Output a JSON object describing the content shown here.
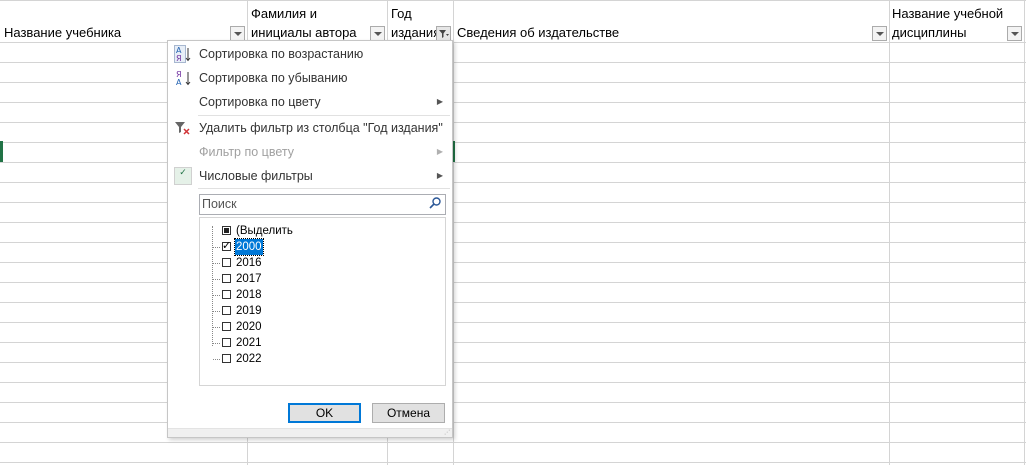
{
  "headers": {
    "col1": "Название учебника",
    "col2_line1": "Фамилия и",
    "col2_line2": "инициалы автора",
    "col3_line1": "Год",
    "col3_line2": "издания",
    "col4": "Сведения об издательстве",
    "col5_line1": "Название учебной",
    "col5_line2": "дисциплины"
  },
  "menu": {
    "sort_asc": "Сортировка по возрастанию",
    "sort_desc": "Сортировка по убыванию",
    "sort_color": "Сортировка по цвету",
    "clear_filter": "Удалить фильтр из столбца \"Год издания\"",
    "filter_color": "Фильтр по цвету",
    "number_filters": "Числовые фильтры",
    "search_placeholder": "Поиск",
    "select_all": "(Выделить все)",
    "items": [
      {
        "label": "2000",
        "checked": true
      },
      {
        "label": "2016",
        "checked": false
      },
      {
        "label": "2017",
        "checked": false
      },
      {
        "label": "2018",
        "checked": false
      },
      {
        "label": "2019",
        "checked": false
      },
      {
        "label": "2020",
        "checked": false
      },
      {
        "label": "2021",
        "checked": false
      },
      {
        "label": "2022",
        "checked": false
      }
    ],
    "ok": "OK",
    "cancel": "Отмена"
  },
  "icons": {
    "sort_asc": "sort-ascending-icon",
    "sort_desc": "sort-descending-icon",
    "clear_filter": "clear-filter-icon",
    "number_filters": "checkmark-icon",
    "search": "search-icon"
  },
  "colors": {
    "excel_green": "#217346",
    "selection_blue": "#0078d7"
  }
}
